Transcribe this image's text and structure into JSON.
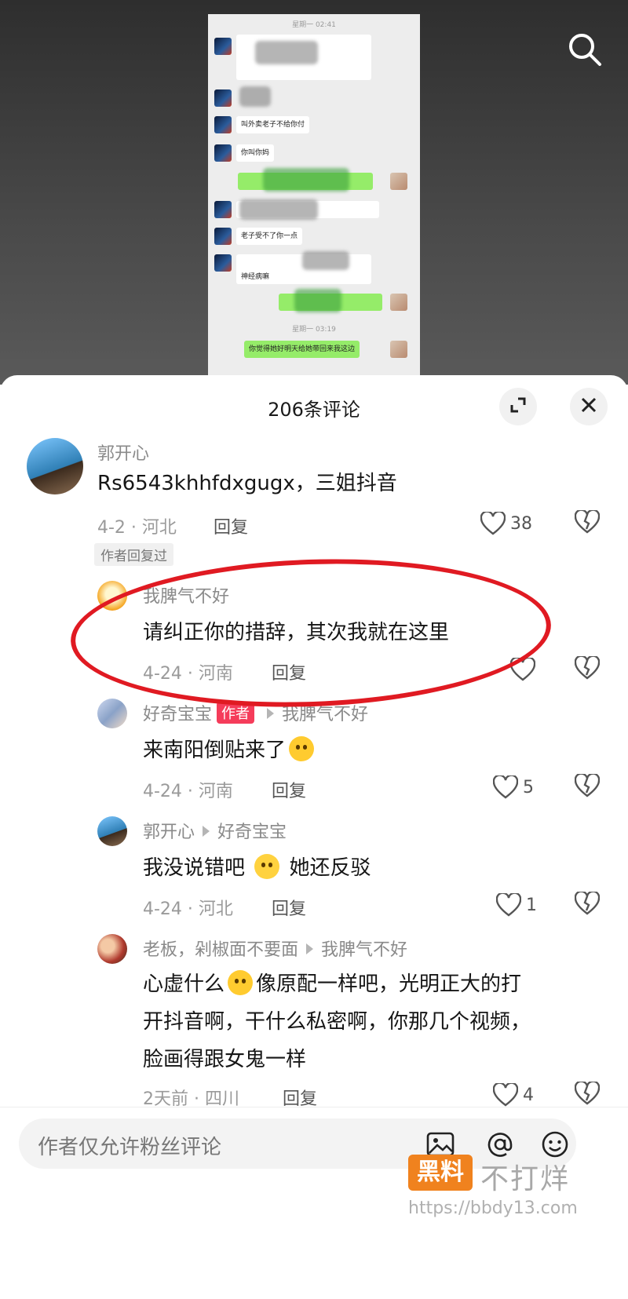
{
  "header": {
    "count_title": "206条评论"
  },
  "screenshot": {
    "timestamp_1": "星期一 02:41",
    "timestamp_2": "星期一 03:19",
    "messages": [
      {
        "text": "叫外卖老子不给你付"
      },
      {
        "text": "你叫你妈"
      },
      {
        "text": "老子受不了你一点"
      },
      {
        "text": "神经病嘛"
      },
      {
        "text": "你觉得她好明天给她带回来我这边"
      }
    ]
  },
  "comments": [
    {
      "user": "郭开心",
      "text": "Rs6543khhfdxgugx，三姐抖音",
      "date": "4-2",
      "region": "河北",
      "reply": "回复",
      "likes": "38",
      "badge": "作者回复过"
    },
    {
      "user": "我脾气不好",
      "text": "请纠正你的措辞，其次我就在这里",
      "date": "4-24",
      "region": "河南",
      "reply": "回复",
      "likes": ""
    },
    {
      "user": "好奇宝宝",
      "author_tag": "作者",
      "reply_to": "我脾气不好",
      "text": "来南阳倒贴来了",
      "date": "4-24",
      "region": "河南",
      "reply": "回复",
      "likes": "5"
    },
    {
      "user": "郭开心",
      "reply_to": "好奇宝宝",
      "text_a": "我没说错吧",
      "text_b": "她还反驳",
      "date": "4-24",
      "region": "河北",
      "reply": "回复",
      "likes": "1"
    },
    {
      "user": "老板，剁椒面不要面",
      "reply_to": "我脾气不好",
      "line1_a": "心虚什么",
      "line1_b": "像原配一样吧，光明正大的打",
      "line2": "开抖音啊，干什么私密啊，你那几个视频，",
      "line3": "脸画得跟女鬼一样",
      "date": "2天前",
      "region": "四川",
      "reply": "回复",
      "likes": "4"
    }
  ],
  "input": {
    "placeholder": "作者仅允许粉丝评论"
  },
  "watermark": {
    "logo": "黑料",
    "text": "不打烊",
    "url": "https://bbdy13.com"
  },
  "icons": [
    "search-icon",
    "expand-icon",
    "close-icon",
    "heart-icon",
    "broken-heart-icon",
    "image-icon",
    "at-icon",
    "emoji-icon"
  ]
}
